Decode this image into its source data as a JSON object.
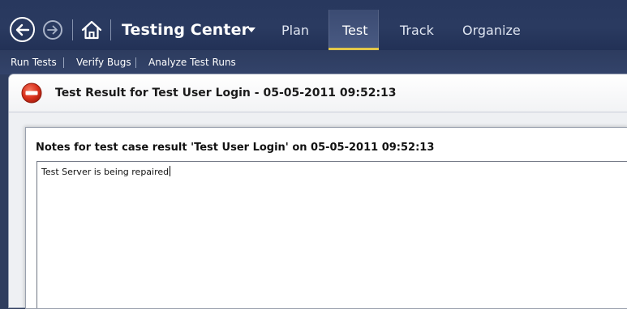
{
  "app": {
    "title": "Testing Center"
  },
  "nav": {
    "tabs": [
      {
        "label": "Plan"
      },
      {
        "label": "Test"
      },
      {
        "label": "Track"
      },
      {
        "label": "Organize"
      }
    ],
    "active_tab": "Test"
  },
  "subnav": {
    "items": [
      {
        "label": "Run Tests"
      },
      {
        "label": "Verify Bugs"
      },
      {
        "label": "Analyze Test Runs"
      }
    ]
  },
  "result": {
    "title": "Test Result for Test User Login - 05-05-2011 09:52:13",
    "status_icon": "stop-icon"
  },
  "notes_dialog": {
    "title": "Notes for test case result 'Test User Login' on 05-05-2011 09:52:13",
    "value": "Test Server is being repaired"
  },
  "icons": {
    "back": "back-arrow-icon",
    "forward": "forward-arrow-icon",
    "home": "home-icon",
    "dropdown": "chevron-down-icon"
  },
  "colors": {
    "nav_background": "#28385e",
    "active_tab_underline": "#e3c84a",
    "error_red": "#d9301c"
  }
}
